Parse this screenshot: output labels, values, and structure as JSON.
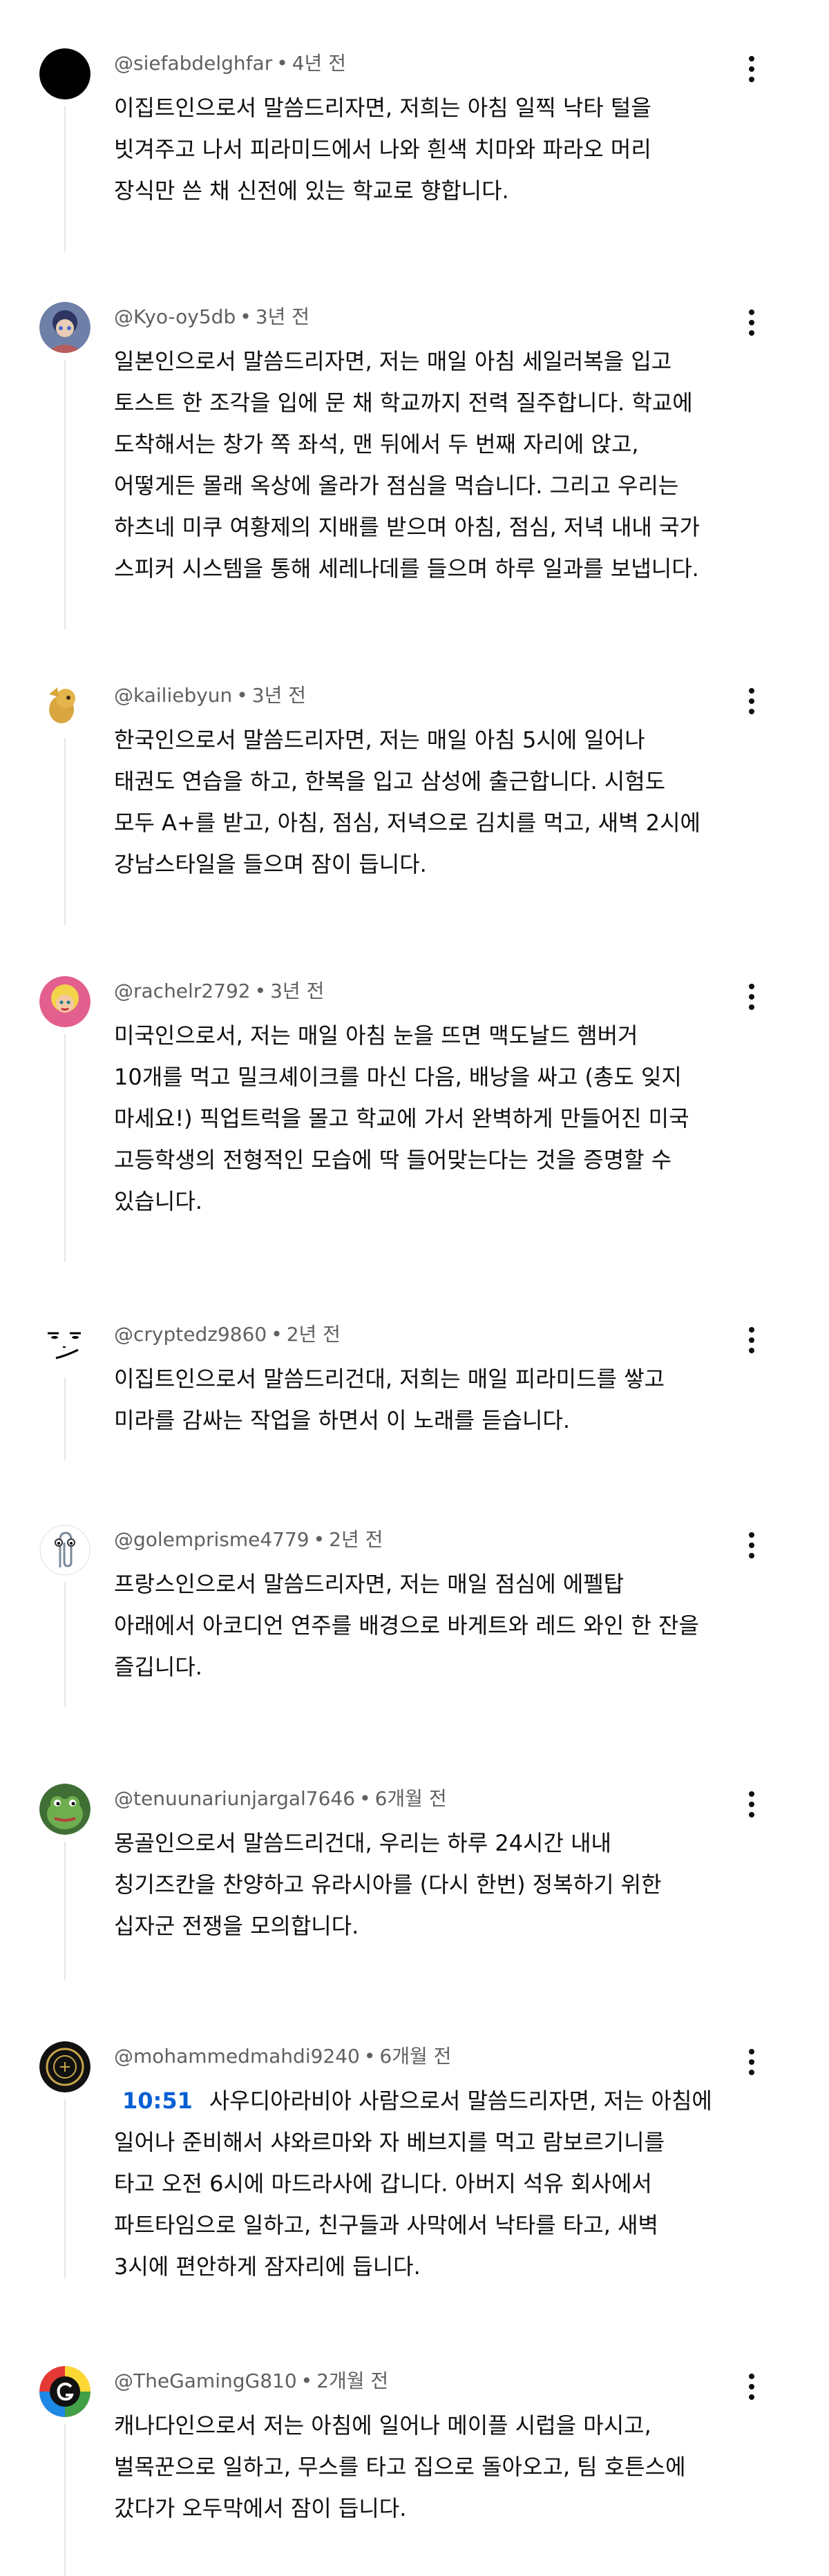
{
  "comments": [
    {
      "author": "@siefabdelghfar",
      "age": "4년 전",
      "lines": [
        "이집트인으로서 말씀드리자면, 저희는 아침 일찍 낙타 털을",
        "빗겨주고 나서 피라미드에서 나와 흰색 치마와 파라오 머리",
        "장식만 쓴 채 신전에 있는 학교로 향합니다."
      ]
    },
    {
      "author": "@Kyo-oy5db",
      "age": "3년 전",
      "lines": [
        "일본인으로서 말씀드리자면, 저는 매일 아침 세일러복을 입고",
        "토스트 한 조각을 입에 문 채 학교까지 전력 질주합니다. 학교에",
        "도착해서는 창가 쪽 좌석, 맨 뒤에서 두 번째 자리에 앉고,",
        "어떻게든 몰래 옥상에 올라가 점심을 먹습니다. 그리고 우리는",
        "하츠네 미쿠 여황제의 지배를 받으며 아침, 점심, 저녁 내내 국가",
        "스피커 시스템을 통해 세레나데를 들으며 하루 일과를 보냅니다."
      ]
    },
    {
      "author": "@kailiebyun",
      "age": "3년 전",
      "lines": [
        "한국인으로서 말씀드리자면, 저는 매일 아침 5시에 일어나",
        "태권도 연습을 하고, 한복을 입고 삼성에 출근합니다. 시험도",
        "모두 A+를 받고, 아침, 점심, 저녁으로 김치를 먹고, 새벽 2시에",
        "강남스타일을 들으며 잠이 듭니다."
      ]
    },
    {
      "author": "@rachelr2792",
      "age": "3년 전",
      "lines": [
        "미국인으로서, 저는 매일 아침 눈을 뜨면 맥도날드 햄버거",
        "10개를 먹고 밀크셰이크를 마신 다음, 배낭을 싸고 (총도 잊지",
        "마세요!) 픽업트럭을 몰고 학교에 가서 완벽하게 만들어진 미국",
        "고등학생의 전형적인 모습에 딱 들어맞는다는 것을 증명할 수",
        "있습니다."
      ]
    },
    {
      "author": "@cryptedz9860",
      "age": "2년 전",
      "lines": [
        "이집트인으로서 말씀드리건대, 저희는 매일 피라미드를 쌓고",
        "미라를 감싸는 작업을 하면서 이 노래를 듣습니다."
      ]
    },
    {
      "author": "@golemprisme4779",
      "age": "2년 전",
      "lines": [
        "프랑스인으로서 말씀드리자면, 저는 매일 점심에 에펠탑",
        "아래에서 아코디언 연주를 배경으로 바게트와 레드 와인 한 잔을",
        "즐깁니다."
      ]
    },
    {
      "author": "@tenuunariunjargal7646",
      "age": "6개월 전",
      "lines": [
        "몽골인으로서 말씀드리건대, 우리는 하루 24시간 내내",
        "칭기즈칸을 찬양하고 유라시아를 (다시 한번) 정복하기 위한",
        "십자군 전쟁을 모의합니다."
      ]
    },
    {
      "author": "@mohammedmahdi9240",
      "age": "6개월 전",
      "timestamp": "10:51",
      "first_line": "사우디아라비아 사람으로서 말씀드리자면, 저는 아침에",
      "lines": [
        "일어나 준비해서 샤와르마와 자 베브지를 먹고 람보르기니를",
        "타고 오전 6시에 마드라사에 갑니다. 아버지 석유 회사에서",
        "파트타임으로 일하고, 친구들과 사막에서 낙타를 타고, 새벽",
        "3시에 편안하게 잠자리에 듭니다."
      ]
    },
    {
      "author": "@TheGamingG810",
      "age": "2개월 전",
      "lines": [
        "캐나다인으로서 저는 아침에 일어나 메이플 시럽을 마시고,",
        "벌목꾼으로 일하고, 무스를 타고 집으로 돌아오고, 팀 호튼스에",
        "갔다가 오두막에서 잠이 듭니다."
      ]
    }
  ]
}
